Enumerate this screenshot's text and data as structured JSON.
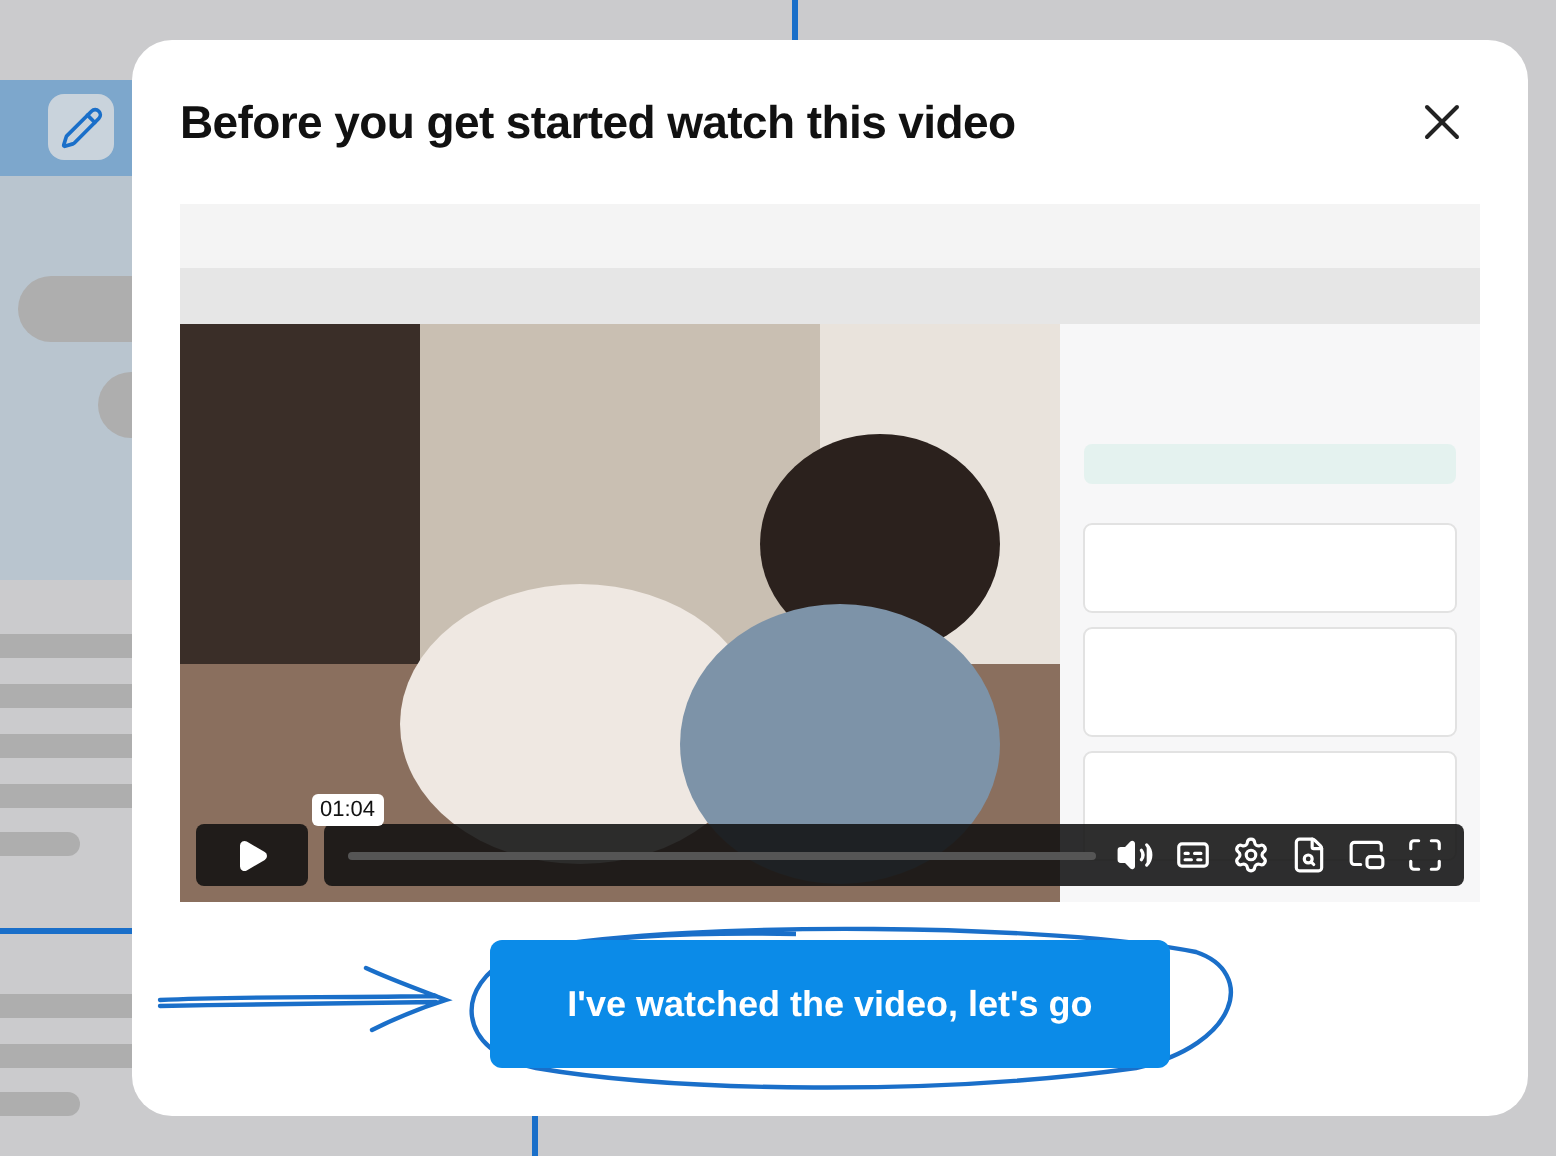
{
  "modal": {
    "title": "Before you get started watch this video",
    "video": {
      "kind": "picture",
      "current_time": "01:04"
    },
    "confirm_button": "I've watched the video, let's go"
  }
}
